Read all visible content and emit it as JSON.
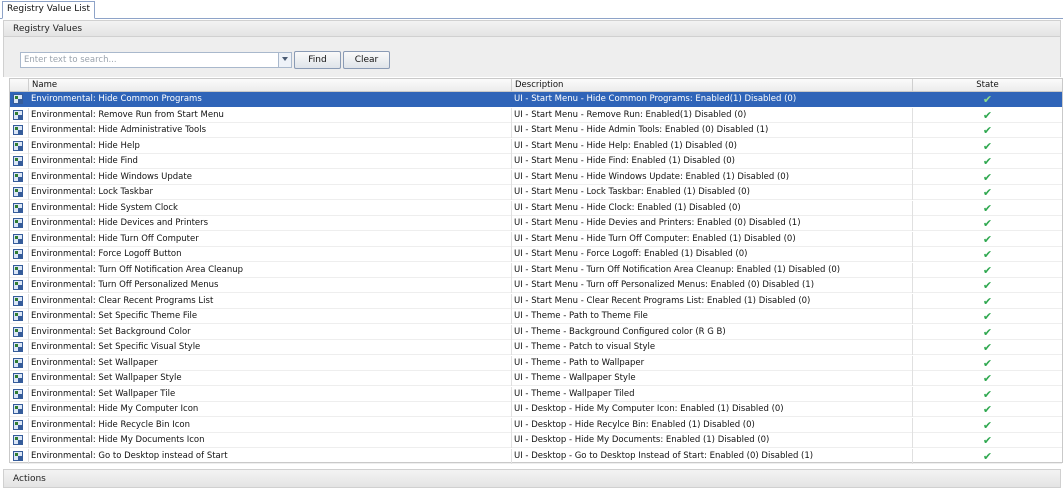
{
  "tab": {
    "label": "Registry Value List"
  },
  "panel": {
    "title": "Registry Values"
  },
  "search": {
    "placeholder": "Enter text to search...",
    "value": ""
  },
  "buttons": {
    "find": "Find",
    "clear": "Clear"
  },
  "columns": {
    "name": "Name",
    "description": "Description",
    "state": "State"
  },
  "state_icon": "check-icon",
  "colors": {
    "selection": "#2f64b8",
    "check": "#2fa84f"
  },
  "selected_row": 0,
  "rows": [
    {
      "name": "Environmental: Hide Common Programs",
      "description": "UI - Start Menu - Hide Common Programs: Enabled(1) Disabled (0)",
      "state": "✔"
    },
    {
      "name": "Environmental: Remove Run from Start Menu",
      "description": "UI - Start Menu - Remove Run: Enabled(1) Disabled (0)",
      "state": "✔"
    },
    {
      "name": "Environmental: Hide Administrative Tools",
      "description": "UI - Start Menu - Hide Admin Tools: Enabled (0) Disabled (1)",
      "state": "✔"
    },
    {
      "name": "Environmental: Hide Help",
      "description": "UI - Start Menu - Hide Help: Enabled (1) Disabled (0)",
      "state": "✔"
    },
    {
      "name": "Environmental: Hide Find",
      "description": "UI - Start Menu - Hide Find: Enabled (1) Disabled (0)",
      "state": "✔"
    },
    {
      "name": "Environmental: Hide Windows Update",
      "description": "UI - Start Menu - Hide Windows Update: Enabled (1) Disabled (0)",
      "state": "✔"
    },
    {
      "name": "Environmental: Lock Taskbar",
      "description": "UI - Start Menu - Lock Taskbar: Enabled (1) Disabled (0)",
      "state": "✔"
    },
    {
      "name": "Environmental: Hide System Clock",
      "description": "UI - Start Menu - Hide Clock: Enabled (1) Disabled (0)",
      "state": "✔"
    },
    {
      "name": "Environmental: Hide Devices and Printers",
      "description": "UI - Start Menu - Hide Devies and Printers: Enabled (0) Disabled (1)",
      "state": "✔"
    },
    {
      "name": "Environmental: Hide Turn Off Computer",
      "description": "UI - Start Menu - Hide Turn Off Computer: Enabled (1) Disabled (0)",
      "state": "✔"
    },
    {
      "name": "Environmental: Force Logoff Button",
      "description": "UI - Start Menu - Force Logoff: Enabled (1) Disabled (0)",
      "state": "✔"
    },
    {
      "name": "Environmental: Turn Off Notification Area Cleanup",
      "description": "UI - Start Menu - Turn Off Notification Area Cleanup: Enabled (1) Disabled (0)",
      "state": "✔"
    },
    {
      "name": "Environmental: Turn Off Personalized Menus",
      "description": "UI - Start Menu - Turn off Personalized Menus: Enabled (0) Disabled (1)",
      "state": "✔"
    },
    {
      "name": "Environmental: Clear Recent Programs List",
      "description": "UI - Start Menu - Clear Recent Programs List: Enabled (1) Disabled (0)",
      "state": "✔"
    },
    {
      "name": "Environmental: Set Specific Theme File",
      "description": "UI - Theme - Path to Theme File",
      "state": "✔"
    },
    {
      "name": "Environmental: Set Background Color",
      "description": "UI - Theme - Background Configured color (R G B)",
      "state": "✔"
    },
    {
      "name": "Environmental: Set Specific Visual Style",
      "description": "UI - Theme - Patch to visual Style",
      "state": "✔"
    },
    {
      "name": "Environmental: Set Wallpaper",
      "description": "UI - Theme - Path to Wallpaper",
      "state": "✔"
    },
    {
      "name": "Environmental: Set Wallpaper Style",
      "description": "UI - Theme - Wallpaper Style",
      "state": "✔"
    },
    {
      "name": "Environmental: Set Wallpaper Tile",
      "description": "UI - Theme - Wallpaper Tiled",
      "state": "✔"
    },
    {
      "name": "Environmental: Hide My Computer Icon",
      "description": "UI - Desktop - Hide My Computer Icon: Enabled (1) Disabled (0)",
      "state": "✔"
    },
    {
      "name": "Environmental: Hide Recycle Bin Icon",
      "description": "UI - Desktop - Hide Recylce Bin: Enabled (1) Disabled (0)",
      "state": "✔"
    },
    {
      "name": "Environmental: Hide My Documents Icon",
      "description": "UI - Desktop - Hide My Documents: Enabled (1) Disabled (0)",
      "state": "✔"
    },
    {
      "name": "Environmental: Go to Desktop instead of Start",
      "description": "UI - Desktop - Go to Desktop Instead of Start: Enabled (0) Disabled (1)",
      "state": "✔"
    }
  ],
  "actions": {
    "title": "Actions"
  }
}
